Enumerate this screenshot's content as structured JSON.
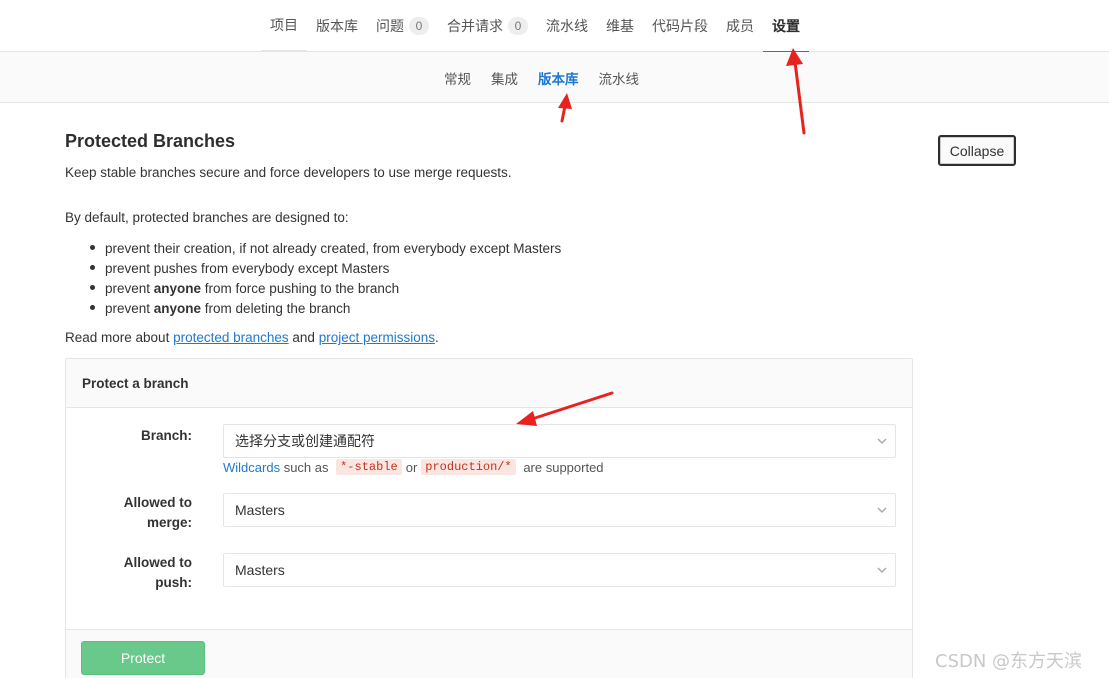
{
  "top_nav": {
    "tabs": [
      {
        "label": "项目"
      },
      {
        "label": "版本库"
      },
      {
        "label": "问题",
        "badge": "0"
      },
      {
        "label": "合并请求",
        "badge": "0"
      },
      {
        "label": "流水线"
      },
      {
        "label": "维基"
      },
      {
        "label": "代码片段"
      },
      {
        "label": "成员"
      },
      {
        "label": "设置",
        "active": true
      }
    ]
  },
  "sub_nav": {
    "tabs": [
      {
        "label": "常规"
      },
      {
        "label": "集成"
      },
      {
        "label": "版本库",
        "active": true
      },
      {
        "label": "流水线"
      }
    ]
  },
  "section": {
    "title": "Protected Branches",
    "description": "Keep stable branches secure and force developers to use merge requests.",
    "collapse_label": "Collapse",
    "intro": "By default, protected branches are designed to:",
    "rules": {
      "r1": "prevent their creation, if not already created, from everybody except Masters",
      "r2": "prevent pushes from everybody except Masters",
      "r3_pre": "prevent ",
      "r3_bold": "anyone",
      "r3_post": " from force pushing to the branch",
      "r4_pre": "prevent ",
      "r4_bold": "anyone",
      "r4_post": " from deleting the branch"
    },
    "read_more": {
      "prefix": "Read more about ",
      "link1": "protected branches",
      "middle": " and ",
      "link2": "project permissions",
      "suffix": "."
    }
  },
  "protect_form": {
    "header": "Protect a branch",
    "branch_label": "Branch:",
    "branch_placeholder": "选择分支或创建通配符",
    "help": {
      "wildcards": "Wildcards",
      "such_as": " such as ",
      "code1": "*-stable",
      "or": "or",
      "code2": "production/*",
      "supported": " are supported"
    },
    "merge_label_1": "Allowed to",
    "merge_label_2": "merge:",
    "merge_value": "Masters",
    "push_label_1": "Allowed to",
    "push_label_2": "push:",
    "push_value": "Masters",
    "submit_label": "Protect"
  },
  "colors": {
    "accent": "#1f78d1",
    "protect_button": "#69c98b",
    "annotation_arrow": "#e8231f"
  },
  "watermark": "CSDN @东方天滨"
}
